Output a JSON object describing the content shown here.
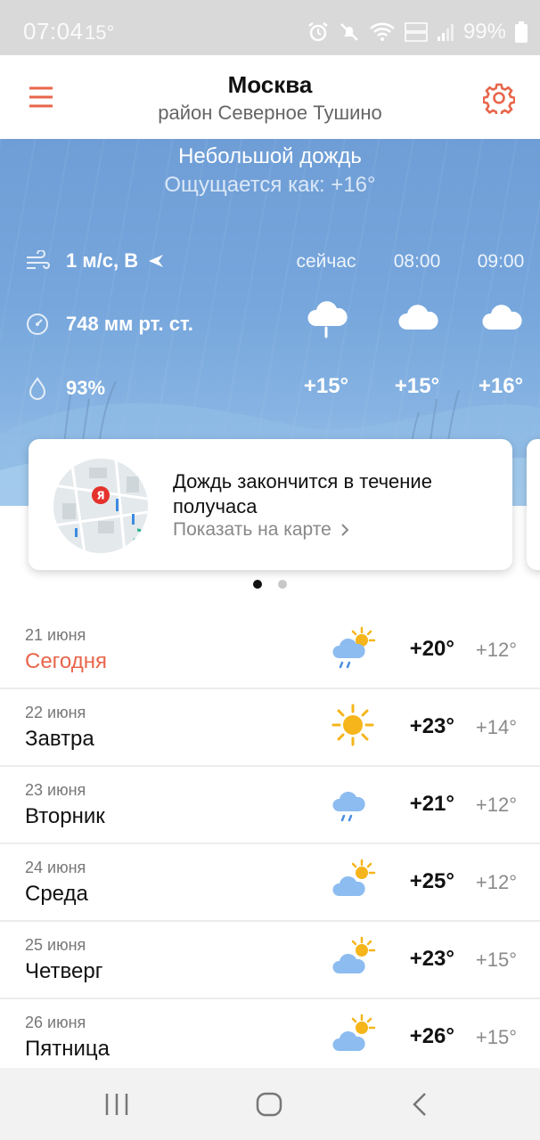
{
  "status_bar": {
    "time": "07:04",
    "temp": "15°",
    "battery": "99%",
    "icons": [
      "alarm-icon",
      "mute-icon",
      "wifi-icon",
      "volte-lte-icon",
      "signal-icon",
      "battery-icon"
    ]
  },
  "header": {
    "city": "Москва",
    "district": "район Северное Тушино",
    "accent_color": "#e8654a"
  },
  "current": {
    "condition": "Небольшой дождь",
    "feels_like": "Ощущается как: +16°",
    "wind": "1 м/с, В",
    "pressure": "748 мм рт. ст.",
    "humidity": "93%"
  },
  "hourly": [
    {
      "time": "сейчас",
      "temp": "+15°",
      "icon": "cloud-rain-icon"
    },
    {
      "time": "08:00",
      "temp": "+15°",
      "icon": "cloud-icon"
    },
    {
      "time": "09:00",
      "temp": "+16°",
      "icon": "cloud-icon"
    }
  ],
  "nowcast": {
    "text": "Дождь закончится в течение получаса",
    "link": "Показать на карте",
    "map_marker": "Я"
  },
  "days": [
    {
      "date": "21 июня",
      "name": "Сегодня",
      "max": "+20°",
      "min": "+12°",
      "icon": "sun-cloud-rain-icon",
      "today": true
    },
    {
      "date": "22 июня",
      "name": "Завтра",
      "max": "+23°",
      "min": "+14°",
      "icon": "sun-icon"
    },
    {
      "date": "23 июня",
      "name": "Вторник",
      "max": "+21°",
      "min": "+12°",
      "icon": "cloud-rain-icon"
    },
    {
      "date": "24 июня",
      "name": "Среда",
      "max": "+25°",
      "min": "+12°",
      "icon": "sun-cloud-icon"
    },
    {
      "date": "25 июня",
      "name": "Четверг",
      "max": "+23°",
      "min": "+15°",
      "icon": "sun-cloud-icon"
    },
    {
      "date": "26 июня",
      "name": "Пятница",
      "max": "+26°",
      "min": "+15°",
      "icon": "sun-cloud-icon"
    }
  ]
}
